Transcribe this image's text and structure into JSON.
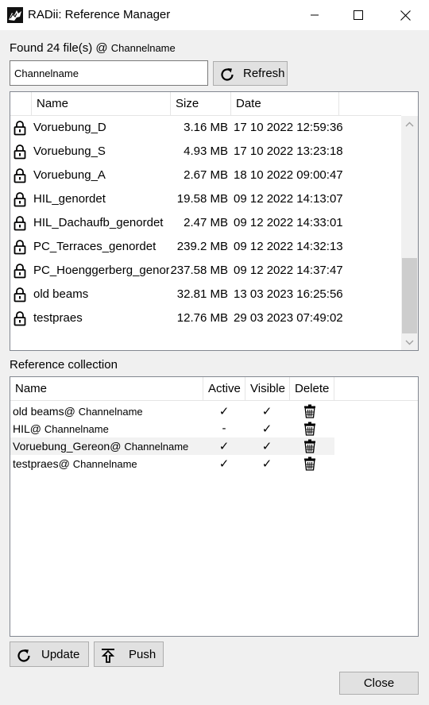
{
  "window": {
    "title": "RADii: Reference Manager",
    "icon": "rhino-icon"
  },
  "found": {
    "text": "Found 24 file(s) @ ",
    "channel": "Channelname"
  },
  "channel_input": {
    "value": "Channelname"
  },
  "refresh_button": {
    "label": "Refresh",
    "icon": "refresh-icon"
  },
  "file_list": {
    "columns": [
      "Name",
      "Size",
      "Date"
    ],
    "rows": [
      {
        "name": "Voruebung_D",
        "size": "3.16 MB",
        "date": "17 10 2022 12:59:36"
      },
      {
        "name": "Voruebung_S",
        "size": "4.93 MB",
        "date": "17 10 2022 13:23:18"
      },
      {
        "name": "Voruebung_A",
        "size": "2.67 MB",
        "date": "18 10 2022 09:00:47"
      },
      {
        "name": "HIL_genordet",
        "size": "19.58 MB",
        "date": "09 12 2022 14:13:07"
      },
      {
        "name": "HIL_Dachaufb_genordet",
        "size": "2.47 MB",
        "date": "09 12 2022 14:33:01"
      },
      {
        "name": "PC_Terraces_genordet",
        "size": "239.2 MB",
        "date": "09 12 2022 14:32:13"
      },
      {
        "name": "PC_Hoenggerberg_genordet",
        "size": "237.58 MB",
        "date": "09 12 2022 14:37:47"
      },
      {
        "name": "old beams",
        "size": "32.81 MB",
        "date": "13 03 2023 16:25:56"
      },
      {
        "name": "testpraes",
        "size": "12.76 MB",
        "date": "29 03 2023 07:49:02"
      }
    ]
  },
  "reference_section": {
    "label": "Reference collection"
  },
  "reference_list": {
    "columns": [
      "Name",
      "Active",
      "Visible",
      "Delete"
    ],
    "rows": [
      {
        "name": "old beams@",
        "channel": "Channelname",
        "active": "✓",
        "visible": "✓"
      },
      {
        "name": "HIL@",
        "channel": "Channelname",
        "active": "-",
        "visible": "✓"
      },
      {
        "name": "Voruebung_Gereon@",
        "channel": "Channelname",
        "active": "✓",
        "visible": "✓"
      },
      {
        "name": "testpraes@",
        "channel": "Channelname",
        "active": "✓",
        "visible": "✓"
      }
    ]
  },
  "update_button": {
    "label": "Update",
    "icon": "refresh-icon"
  },
  "push_button": {
    "label": "Push",
    "icon": "upload-icon"
  },
  "close_button": {
    "label": "Close"
  }
}
